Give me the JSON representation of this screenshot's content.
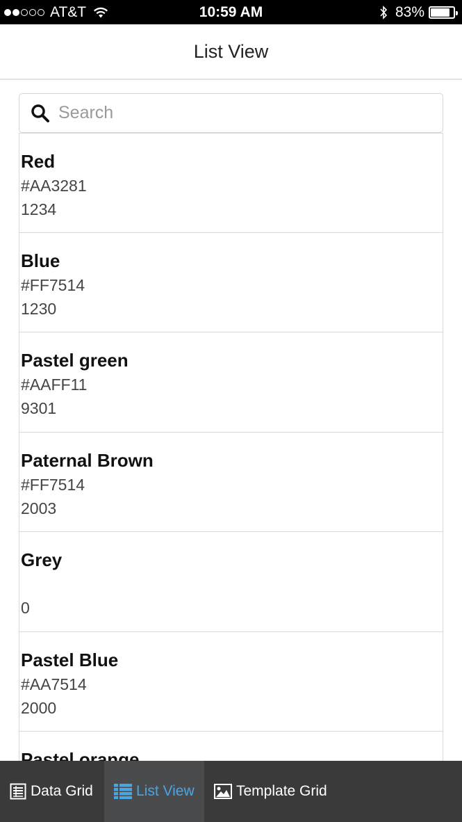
{
  "status_bar": {
    "carrier": "AT&T",
    "signal_bars_filled": 2,
    "signal_bars_total": 5,
    "time": "10:59 AM",
    "battery_percent": "83%",
    "battery_level": 0.83
  },
  "header": {
    "title": "List View"
  },
  "search": {
    "placeholder": "Search",
    "value": ""
  },
  "items": [
    {
      "name": "Red",
      "hex": "#AA3281",
      "code": "1234"
    },
    {
      "name": "Blue",
      "hex": "#FF7514",
      "code": "1230"
    },
    {
      "name": "Pastel green",
      "hex": "#AAFF11",
      "code": "9301"
    },
    {
      "name": "Paternal Brown",
      "hex": "#FF7514",
      "code": "2003"
    },
    {
      "name": "Grey",
      "hex": "",
      "code": "0"
    },
    {
      "name": "Pastel Blue",
      "hex": "#AA7514",
      "code": "2000"
    },
    {
      "name": "Pastel orange",
      "hex": "",
      "code": ""
    }
  ],
  "tabs": [
    {
      "label": "Data Grid",
      "icon": "table-icon",
      "active": false
    },
    {
      "label": "List View",
      "icon": "list-icon",
      "active": true
    },
    {
      "label": "Template Grid",
      "icon": "image-icon",
      "active": false
    }
  ],
  "colors": {
    "accent": "#47A7E6",
    "tabbar_bg": "#3A3A3A",
    "tab_active_bg": "#4A4B4D"
  }
}
